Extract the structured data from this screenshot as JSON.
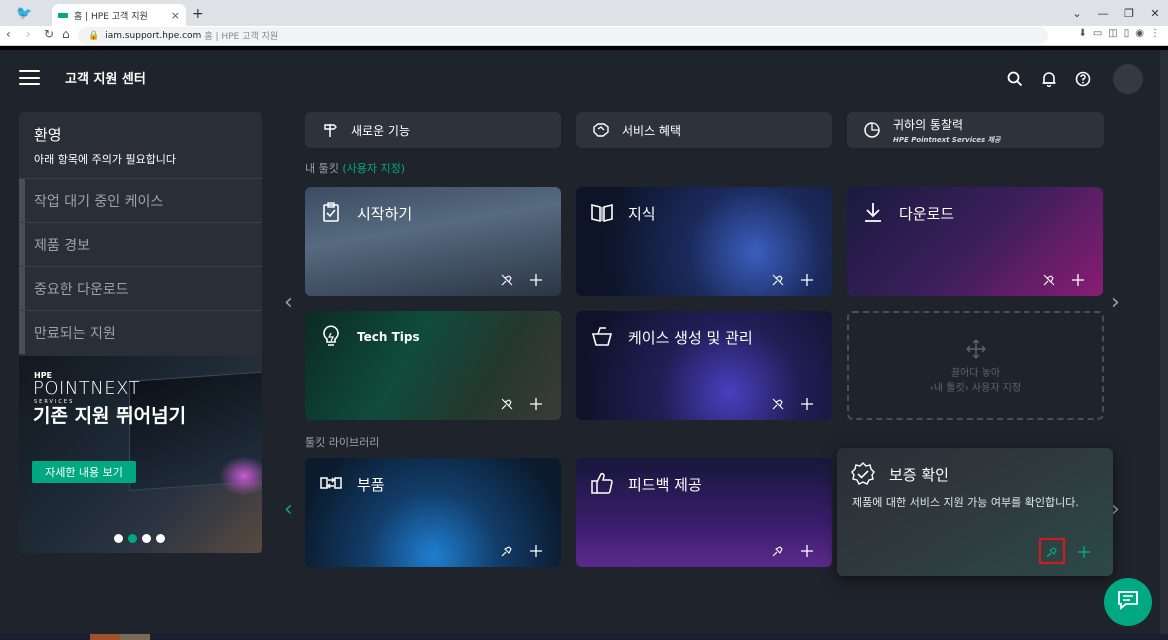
{
  "browser": {
    "active_tab_title": "홈 | HPE 고객 지원",
    "url_host": "iam.support.hpe.com",
    "url_title": "홈 | HPE 고객 지원",
    "new_tab": "+",
    "close_tab": "×"
  },
  "header": {
    "title": "고객 지원 센터"
  },
  "sidebar": {
    "welcome_title": "환영",
    "welcome_text": "아래 항목에 주의가 필요합니다",
    "items": [
      {
        "label": "작업 대기 중인 케이스"
      },
      {
        "label": "제품 경보"
      },
      {
        "label": "중요한 다운로드"
      },
      {
        "label": "만료되는 지원"
      }
    ],
    "promo": {
      "brand_hpe": "HPE",
      "brand_name": "POINTNEXT",
      "brand_services": "SERVICES",
      "headline": "기존 지원 뛰어넘기",
      "cta": "자세한 내용 보기"
    }
  },
  "quick_links": [
    {
      "label": "새로운 기능",
      "icon": "signpost-icon"
    },
    {
      "label": "서비스 혜택",
      "icon": "handshake-icon"
    },
    {
      "label": "귀하의 통찰력",
      "sub": "HPE Pointnext Services 제공",
      "icon": "insight-icon"
    }
  ],
  "my_tools": {
    "label": "내 툴킷",
    "custom": "(사용자 지정)",
    "cards": [
      {
        "title": "시작하기",
        "icon": "clipboard-check-icon"
      },
      {
        "title": "지식",
        "icon": "book-icon"
      },
      {
        "title": "다운로드",
        "icon": "download-icon"
      },
      {
        "title": "Tech Tips",
        "icon": "lightbulb-icon"
      },
      {
        "title": "케이스 생성 및 관리",
        "icon": "basket-icon"
      }
    ],
    "drop_line1": "끌어다 놓아",
    "drop_line2": "‹내 툴킷› 사용자 지정"
  },
  "library": {
    "label": "툴킷 라이브러리",
    "cards": [
      {
        "title": "부품",
        "icon": "swap-icon"
      },
      {
        "title": "피드백 제공",
        "icon": "thumbs-up-icon"
      },
      {
        "title": "보증 확인",
        "desc": "제품에 대한 서비스 지원 가능 여부를 확인합니다.",
        "icon": "verified-badge-icon"
      }
    ]
  },
  "colors": {
    "accent": "#01a982",
    "background": "#1f232b",
    "panel": "#2a2e36",
    "highlight": "#e0141e"
  }
}
